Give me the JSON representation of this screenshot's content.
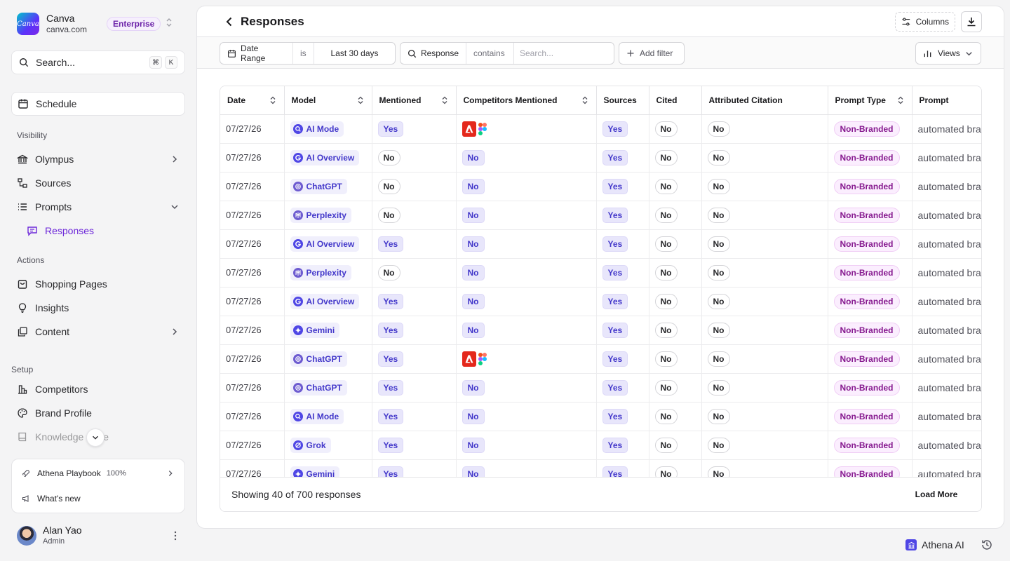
{
  "org": {
    "name": "Canva",
    "domain": "canva.com",
    "plan": "Enterprise",
    "logo_text": "Canva"
  },
  "search": {
    "placeholder": "Search...",
    "kbd1": "⌘",
    "kbd2": "K"
  },
  "nav": {
    "schedule": "Schedule",
    "visibility_label": "Visibility",
    "olympus": "Olympus",
    "sources": "Sources",
    "prompts": "Prompts",
    "responses": "Responses",
    "actions_label": "Actions",
    "shopping_pages": "Shopping Pages",
    "insights": "Insights",
    "content": "Content",
    "setup_label": "Setup",
    "competitors": "Competitors",
    "brand_profile": "Brand Profile",
    "knowledge_base": "Knowledge Base"
  },
  "bottom_card": {
    "playbook": "Athena Playbook",
    "playbook_pct": "100%",
    "whats_new": "What's new"
  },
  "user": {
    "name": "Alan Yao",
    "role": "Admin"
  },
  "header": {
    "title": "Responses",
    "columns_label": "Columns"
  },
  "filters": {
    "date_field": "Date Range",
    "date_op": "is",
    "date_value": "Last 30 days",
    "response_field": "Response",
    "response_op": "contains",
    "response_placeholder": "Search...",
    "add_filter": "Add filter",
    "views": "Views"
  },
  "table": {
    "columns": [
      "Date",
      "Model",
      "Mentioned",
      "Competitors Mentioned",
      "Sources",
      "Cited",
      "Attributed Citation",
      "Prompt Type",
      "Prompt"
    ],
    "rows": [
      {
        "date": "07/27/26",
        "model": "AI Mode",
        "mentioned": "Yes",
        "competitors": "logos",
        "sources": "Yes",
        "cited": "No",
        "attributed": "No",
        "type": "Non-Branded",
        "prompt": "automated bra"
      },
      {
        "date": "07/27/26",
        "model": "AI Overview",
        "mentioned": "No",
        "competitors": "No",
        "sources": "Yes",
        "cited": "No",
        "attributed": "No",
        "type": "Non-Branded",
        "prompt": "automated bra"
      },
      {
        "date": "07/27/26",
        "model": "ChatGPT",
        "mentioned": "No",
        "competitors": "No",
        "sources": "Yes",
        "cited": "No",
        "attributed": "No",
        "type": "Non-Branded",
        "prompt": "automated bra"
      },
      {
        "date": "07/27/26",
        "model": "Perplexity",
        "mentioned": "No",
        "competitors": "No",
        "sources": "Yes",
        "cited": "No",
        "attributed": "No",
        "type": "Non-Branded",
        "prompt": "automated bra"
      },
      {
        "date": "07/27/26",
        "model": "AI Overview",
        "mentioned": "Yes",
        "competitors": "No",
        "sources": "Yes",
        "cited": "No",
        "attributed": "No",
        "type": "Non-Branded",
        "prompt": "automated bra"
      },
      {
        "date": "07/27/26",
        "model": "Perplexity",
        "mentioned": "No",
        "competitors": "No",
        "sources": "Yes",
        "cited": "No",
        "attributed": "No",
        "type": "Non-Branded",
        "prompt": "automated bra"
      },
      {
        "date": "07/27/26",
        "model": "AI Overview",
        "mentioned": "Yes",
        "competitors": "No",
        "sources": "Yes",
        "cited": "No",
        "attributed": "No",
        "type": "Non-Branded",
        "prompt": "automated bra"
      },
      {
        "date": "07/27/26",
        "model": "Gemini",
        "mentioned": "Yes",
        "competitors": "No",
        "sources": "Yes",
        "cited": "No",
        "attributed": "No",
        "type": "Non-Branded",
        "prompt": "automated bra"
      },
      {
        "date": "07/27/26",
        "model": "ChatGPT",
        "mentioned": "Yes",
        "competitors": "logos",
        "sources": "Yes",
        "cited": "No",
        "attributed": "No",
        "type": "Non-Branded",
        "prompt": "automated bra"
      },
      {
        "date": "07/27/26",
        "model": "ChatGPT",
        "mentioned": "Yes",
        "competitors": "No",
        "sources": "Yes",
        "cited": "No",
        "attributed": "No",
        "type": "Non-Branded",
        "prompt": "automated bra"
      },
      {
        "date": "07/27/26",
        "model": "AI Mode",
        "mentioned": "Yes",
        "competitors": "No",
        "sources": "Yes",
        "cited": "No",
        "attributed": "No",
        "type": "Non-Branded",
        "prompt": "automated bra"
      },
      {
        "date": "07/27/26",
        "model": "Grok",
        "mentioned": "Yes",
        "competitors": "No",
        "sources": "Yes",
        "cited": "No",
        "attributed": "No",
        "type": "Non-Branded",
        "prompt": "automated bra"
      },
      {
        "date": "07/27/26",
        "model": "Gemini",
        "mentioned": "Yes",
        "competitors": "No",
        "sources": "Yes",
        "cited": "No",
        "attributed": "No",
        "type": "Non-Branded",
        "prompt": "automated bra"
      }
    ],
    "footer_count": "Showing 40 of 700 responses",
    "load_more": "Load More"
  },
  "assistant": {
    "label": "Athena AI"
  },
  "colors": {
    "accent": "#4338ca",
    "brand_purple": "#6d28d9",
    "type_pink": "#86198f"
  }
}
